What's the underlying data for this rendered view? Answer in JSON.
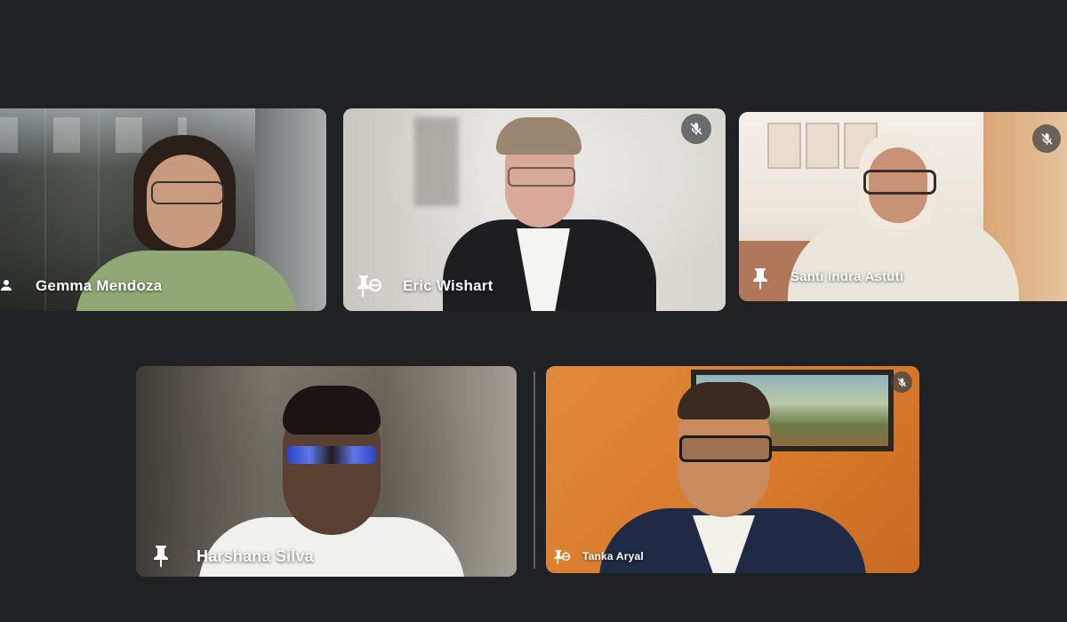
{
  "meeting": {
    "participants": [
      {
        "name": "Gemma Mendoza",
        "muted": false,
        "label_icon": "camera-icon"
      },
      {
        "name": "Eric Wishart",
        "muted": true,
        "label_icon": "pin-icon"
      },
      {
        "name": "Santi Indra Astuti",
        "muted": true,
        "label_icon": "pin-icon"
      },
      {
        "name": "Harshana Silva",
        "muted": false,
        "label_icon": "pin-icon"
      },
      {
        "name": "Tanka Aryal",
        "muted": true,
        "label_icon": "pin-icon"
      }
    ]
  },
  "colors": {
    "background": "#202124",
    "label_text": "#ffffff",
    "mute_button_bg": "#3c4043"
  }
}
